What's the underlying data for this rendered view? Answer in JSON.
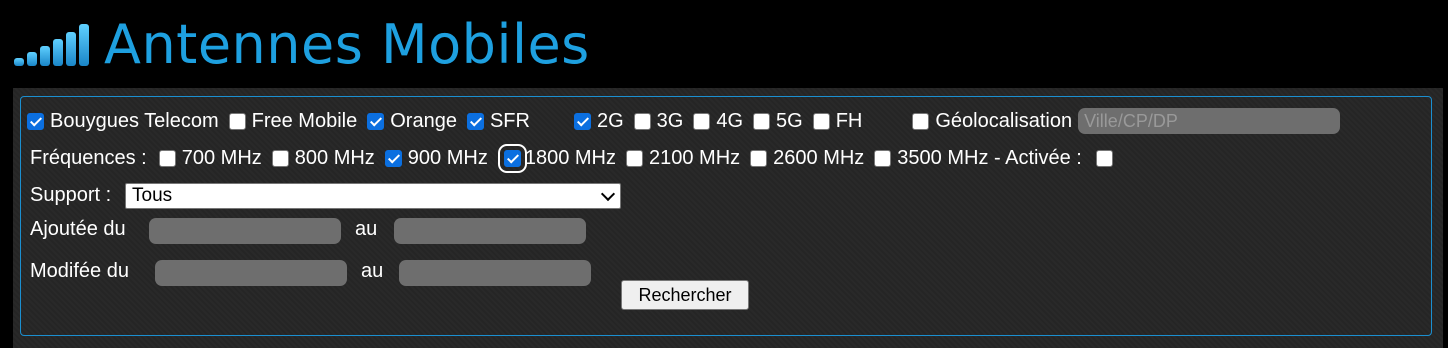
{
  "header": {
    "title": "Antennes Mobiles",
    "logo_icon": "signal-bars-icon"
  },
  "operators": [
    {
      "label": "Bouygues Telecom",
      "checked": true
    },
    {
      "label": "Free Mobile",
      "checked": false
    },
    {
      "label": "Orange",
      "checked": true
    },
    {
      "label": "SFR",
      "checked": true
    }
  ],
  "technologies": [
    {
      "label": "2G",
      "checked": true
    },
    {
      "label": "3G",
      "checked": false
    },
    {
      "label": "4G",
      "checked": false
    },
    {
      "label": "5G",
      "checked": false
    },
    {
      "label": "FH",
      "checked": false
    }
  ],
  "geolocation": {
    "label": "Géolocalisation",
    "checked": false,
    "placeholder": "Ville/CP/DP"
  },
  "frequencies": {
    "label": "Fréquences :",
    "items": [
      {
        "label": "700 MHz",
        "checked": false
      },
      {
        "label": "800 MHz",
        "checked": false
      },
      {
        "label": "900 MHz",
        "checked": true
      },
      {
        "label": "1800 MHz",
        "checked": true
      },
      {
        "label": "2100 MHz",
        "checked": false
      },
      {
        "label": "2600 MHz",
        "checked": false
      },
      {
        "label": "3500 MHz - Activée :",
        "checked": false
      }
    ],
    "activated_checked": false
  },
  "support": {
    "label": "Support :",
    "selected": "Tous"
  },
  "added": {
    "label": "Ajoutée du",
    "au": "au",
    "from": "",
    "to": ""
  },
  "modified": {
    "label": "Modifée du",
    "au": "au",
    "from": "",
    "to": ""
  },
  "search_button": "Rechercher",
  "colors": {
    "accent": "#1ea0e0",
    "checkbox_checked": "#0b6fe0",
    "panel_bg": "#252525",
    "field_bg": "#6e6e6e"
  }
}
